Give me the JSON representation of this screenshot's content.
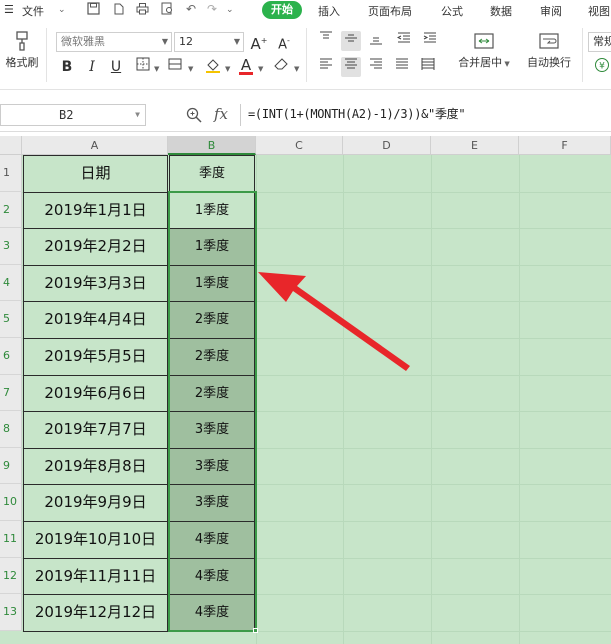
{
  "menu": {
    "file_label": "文件",
    "tabs": [
      "开始",
      "插入",
      "页面布局",
      "公式",
      "数据",
      "审阅",
      "视图"
    ],
    "active_tab": "开始"
  },
  "ribbon": {
    "format_painter_label": "格式刷",
    "font_name": "微软雅黑",
    "font_size": "12",
    "merge_center_label": "合并居中",
    "wrap_text_label": "自动换行",
    "number_format_label": "常规"
  },
  "formula_bar": {
    "name_box": "B2",
    "fx_label": "fx",
    "formula": "=(INT(1+(MONTH(A2)-1)/3))&\"季度\""
  },
  "grid": {
    "columns": [
      "A",
      "B",
      "C",
      "D",
      "E",
      "F"
    ],
    "selected_column": "B",
    "row_numbers": [
      "1",
      "2",
      "3",
      "4",
      "5",
      "6",
      "7",
      "8",
      "9",
      "10",
      "11",
      "12",
      "13"
    ],
    "headers": {
      "a": "日期",
      "b": "季度"
    },
    "rows": [
      {
        "a": "2019年1月1日",
        "b": "1季度"
      },
      {
        "a": "2019年2月2日",
        "b": "1季度"
      },
      {
        "a": "2019年3月3日",
        "b": "1季度"
      },
      {
        "a": "2019年4月4日",
        "b": "2季度"
      },
      {
        "a": "2019年5月5日",
        "b": "2季度"
      },
      {
        "a": "2019年6月6日",
        "b": "2季度"
      },
      {
        "a": "2019年7月7日",
        "b": "3季度"
      },
      {
        "a": "2019年8月8日",
        "b": "3季度"
      },
      {
        "a": "2019年9月9日",
        "b": "3季度"
      },
      {
        "a": "2019年10月10日",
        "b": "4季度"
      },
      {
        "a": "2019年11月11日",
        "b": "4季度"
      },
      {
        "a": "2019年12月12日",
        "b": "4季度"
      }
    ]
  },
  "colors": {
    "accent": "#2bb24c",
    "sheet_background": "#c7e5c9",
    "selected_cells": "#9fbf9f",
    "selection_border": "#3c9a48",
    "annotation_arrow": "#e8262a"
  },
  "icons": [
    "menu-icon",
    "chevron-down-icon",
    "save-icon",
    "print-icon",
    "undo-icon",
    "redo-icon",
    "zoom-icon",
    "arrow-annotation-icon"
  ]
}
